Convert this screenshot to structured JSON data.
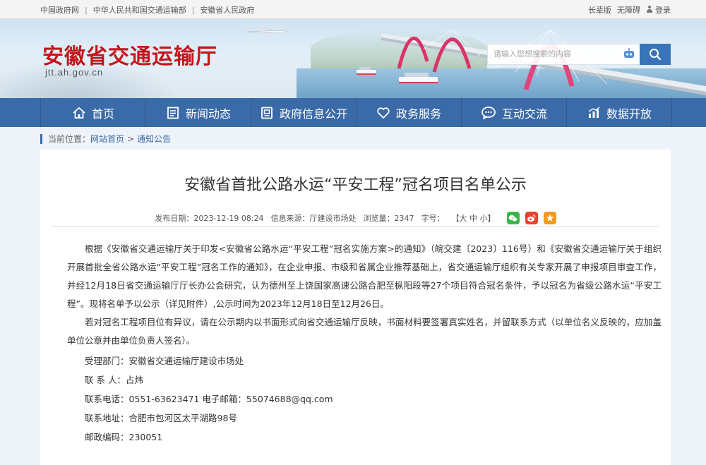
{
  "topbar": {
    "links": [
      "中国政府网",
      "中华人民共和国交通运输部",
      "安徽省人民政府"
    ],
    "right": {
      "elder": "长辈版",
      "accessible": "无障碍",
      "login": "登录"
    }
  },
  "header": {
    "title": "安徽省交通运输厅",
    "domain": "jtt.ah.gov.cn",
    "search_placeholder": "请输入您想搜索的内容"
  },
  "nav": {
    "items": [
      {
        "label": "首页",
        "icon": "home-icon"
      },
      {
        "label": "新闻动态",
        "icon": "news-icon"
      },
      {
        "label": "政府信息公开",
        "icon": "info-icon"
      },
      {
        "label": "政务服务",
        "icon": "heart-icon"
      },
      {
        "label": "互动交流",
        "icon": "chat-icon"
      },
      {
        "label": "数据开放",
        "icon": "chart-icon"
      }
    ]
  },
  "breadcrumb": {
    "prefix": "当前位置：",
    "items": [
      "网站首页",
      "通知公告"
    ],
    "separator": ">"
  },
  "article": {
    "title": "安徽省首批公路水运“平安工程”冠名项目名单公示",
    "meta": {
      "date": "发布日期：2023-12-19 08:24",
      "source": "信息来源：厅建设市场处",
      "views": "浏览量：2347",
      "font_label": "字号：",
      "font_sizes": "【大 中 小】"
    },
    "paragraphs": [
      "根据《安徽省交通运输厅关于印发<安徽省公路水运“平安工程”冠名实施方案>的通知》（皖交建〔2023〕116号）和《安徽省交通运输厅关于组织开展首批全省公路水运“平安工程”冠名工作的通知》，在企业申报、市级和省属企业推荐基础上，省交通运输厅组织有关专家开展了申报项目审查工作，并经12月18日省交通运输厅厅长办公会研究，认为德州至上饶国家高速公路合肥至枞阳段等27个项目符合冠名条件，予以冠名为省级公路水运“平安工程”。现将名单予以公示（详见附件）,公示时间为2023年12月18日至12月26日。",
      "若对冠名工程项目位有异议，请在公示期内以书面形式向省交通运输厅反映，书面材料要签署真实姓名，并留联系方式（以单位名义反映的，应加盖单位公章并由单位负责人签名）。"
    ],
    "contacts": [
      "受理部门：安徽省交通运输厅建设市场处",
      "联 系 人：占炜",
      "联系电话：0551-63623471 电子邮箱：55074688@qq.com",
      "联系地址：合肥市包河区太平湖路98号",
      "邮政编码：230051"
    ]
  },
  "colors": {
    "brand_red": "#c4161c",
    "nav_blue": "#3b6aa8",
    "link_blue": "#3a6aa6"
  }
}
